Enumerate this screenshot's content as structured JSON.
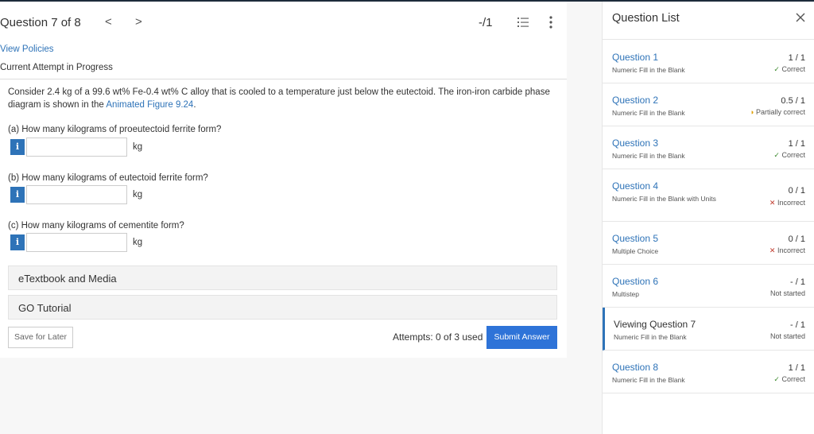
{
  "header": {
    "question_position": "Question 7 of 8",
    "prev_glyph": "<",
    "next_glyph": ">",
    "score": "-/1"
  },
  "links": {
    "view_policies": "View Policies",
    "attempt_status": "Current Attempt in Progress"
  },
  "prompt": {
    "text_before": "Consider 2.4 kg of a 99.6 wt% Fe-0.4 wt% C alloy that is cooled to a temperature just below the eutectoid. The iron-iron carbide phase diagram is shown in the ",
    "link_text": "Animated Figure 9.24",
    "text_after": "."
  },
  "parts": [
    {
      "label": "(a) How many kilograms of proeutectoid ferrite form?",
      "value": "",
      "unit": "kg",
      "info": "i"
    },
    {
      "label": "(b) How many kilograms of eutectoid ferrite form?",
      "value": "",
      "unit": "kg",
      "info": "i"
    },
    {
      "label": "(c) How many kilograms of cementite form?",
      "value": "",
      "unit": "kg",
      "info": "i"
    }
  ],
  "panels": {
    "etextbook": "eTextbook and Media",
    "go_tutorial": "GO Tutorial"
  },
  "footer": {
    "save_label": "Save for Later",
    "attempts": "Attempts: 0 of 3 used",
    "submit_label": "Submit Answer"
  },
  "question_list": {
    "title": "Question List",
    "items": [
      {
        "name": "Question 1",
        "type": "Numeric Fill in the Blank",
        "score": "1 / 1",
        "status": "Correct",
        "mark": "✓"
      },
      {
        "name": "Question 2",
        "type": "Numeric Fill in the Blank",
        "score": "0.5 / 1",
        "status": "Partially correct",
        "mark": "◑"
      },
      {
        "name": "Question 3",
        "type": "Numeric Fill in the Blank",
        "score": "1 / 1",
        "status": "Correct",
        "mark": "✓"
      },
      {
        "name": "Question 4",
        "type": "Numeric Fill in the Blank with Units",
        "score": "0 / 1",
        "status": "Incorrect",
        "mark": "✕"
      },
      {
        "name": "Question 5",
        "type": "Multiple Choice",
        "score": "0 / 1",
        "status": "Incorrect",
        "mark": "✕"
      },
      {
        "name": "Question 6",
        "type": "Multistep",
        "score": "- / 1",
        "status": "Not started",
        "mark": ""
      },
      {
        "name": "Viewing Question 7",
        "type": "Numeric Fill in the Blank",
        "score": "- / 1",
        "status": "Not started",
        "mark": ""
      },
      {
        "name": "Question 8",
        "type": "Numeric Fill in the Blank",
        "score": "1 / 1",
        "status": "Correct",
        "mark": "✓"
      }
    ]
  },
  "colors": {
    "accent": "#2e73b8",
    "submit": "#2e73d8",
    "correct": "#3c8a2e",
    "incorrect": "#c0392b",
    "partial": "#e0a000"
  },
  "icons": {
    "list": "numbered-list-icon",
    "more": "more-vertical-icon",
    "close": "close-icon",
    "info": "info-icon"
  }
}
